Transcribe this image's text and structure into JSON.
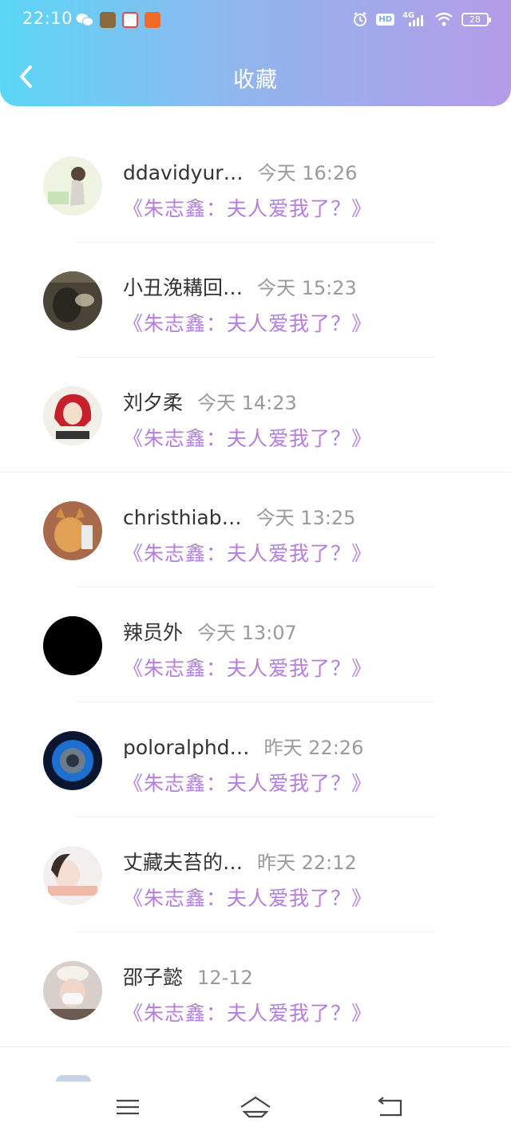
{
  "status_bar": {
    "time": "22:10",
    "network": "4G",
    "hd_label": "HD",
    "battery": "28"
  },
  "header": {
    "title": "收藏"
  },
  "favorites": [
    {
      "name": "ddavidyur…",
      "time": "今天 16:26",
      "title": "《朱志鑫：夫人爱我了？》"
    },
    {
      "name": "小丑浼耩回…",
      "time": "今天 15:23",
      "title": "《朱志鑫：夫人爱我了？》"
    },
    {
      "name": "刘夕柔",
      "time": "今天 14:23",
      "title": "《朱志鑫：夫人爱我了？》"
    },
    {
      "name": "christhiab…",
      "time": "今天 13:25",
      "title": "《朱志鑫：夫人爱我了？》"
    },
    {
      "name": "辣员外",
      "time": "今天 13:07",
      "title": "《朱志鑫：夫人爱我了？》"
    },
    {
      "name": "poloralphd…",
      "time": "昨天 22:26",
      "title": "《朱志鑫：夫人爱我了？》"
    },
    {
      "name": "丈藏夫苔的…",
      "time": "昨天 22:12",
      "title": "《朱志鑫：夫人爱我了？》"
    },
    {
      "name": "邵子懿",
      "time": "12-12",
      "title": "《朱志鑫：夫人爱我了？》"
    }
  ],
  "nav_bar": {
    "buttons": [
      "menu-icon",
      "home-icon",
      "back-icon"
    ]
  },
  "colors": {
    "header_gradient_start": "#5bd6f5",
    "header_gradient_end": "#b59be8",
    "title_purple": "#b37ee0",
    "timestamp_gray": "#9a9a9a"
  }
}
